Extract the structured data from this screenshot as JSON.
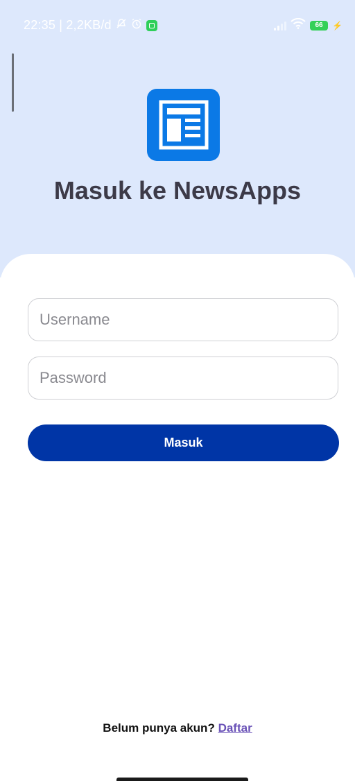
{
  "status_bar": {
    "time_info": "22:35 | 2,2KB/d",
    "battery_level": "66"
  },
  "login": {
    "title": "Masuk ke NewsApps",
    "username_placeholder": "Username",
    "password_placeholder": "Password",
    "submit_label": "Masuk"
  },
  "register": {
    "prompt": "Belum punya akun?",
    "link_label": "Daftar"
  },
  "colors": {
    "hero_background": "#dde8fc",
    "logo_blue": "#0b79e6",
    "primary_button": "#0035a6",
    "link": "#6a52b7"
  },
  "icons": {
    "logo": "newspaper-icon",
    "status": [
      "mute-icon",
      "alarm-icon",
      "app-notification-icon",
      "signal-icon",
      "wifi-icon",
      "battery-icon",
      "charging-icon"
    ]
  }
}
